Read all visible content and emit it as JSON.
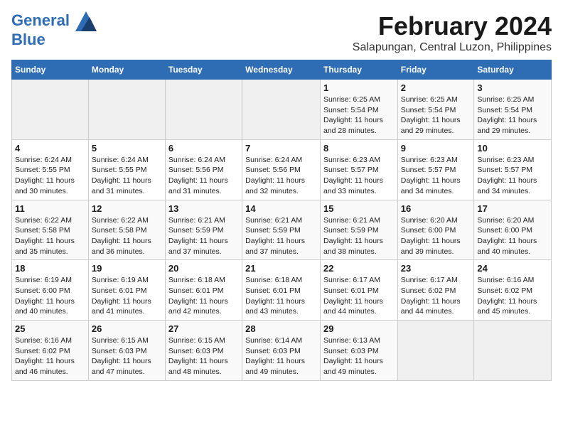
{
  "header": {
    "logo_line1": "General",
    "logo_line2": "Blue",
    "month_year": "February 2024",
    "location": "Salapungan, Central Luzon, Philippines"
  },
  "days_of_week": [
    "Sunday",
    "Monday",
    "Tuesday",
    "Wednesday",
    "Thursday",
    "Friday",
    "Saturday"
  ],
  "weeks": [
    [
      {
        "day": "",
        "info": ""
      },
      {
        "day": "",
        "info": ""
      },
      {
        "day": "",
        "info": ""
      },
      {
        "day": "",
        "info": ""
      },
      {
        "day": "1",
        "info": "Sunrise: 6:25 AM\nSunset: 5:54 PM\nDaylight: 11 hours and 28 minutes."
      },
      {
        "day": "2",
        "info": "Sunrise: 6:25 AM\nSunset: 5:54 PM\nDaylight: 11 hours and 29 minutes."
      },
      {
        "day": "3",
        "info": "Sunrise: 6:25 AM\nSunset: 5:54 PM\nDaylight: 11 hours and 29 minutes."
      }
    ],
    [
      {
        "day": "4",
        "info": "Sunrise: 6:24 AM\nSunset: 5:55 PM\nDaylight: 11 hours and 30 minutes."
      },
      {
        "day": "5",
        "info": "Sunrise: 6:24 AM\nSunset: 5:55 PM\nDaylight: 11 hours and 31 minutes."
      },
      {
        "day": "6",
        "info": "Sunrise: 6:24 AM\nSunset: 5:56 PM\nDaylight: 11 hours and 31 minutes."
      },
      {
        "day": "7",
        "info": "Sunrise: 6:24 AM\nSunset: 5:56 PM\nDaylight: 11 hours and 32 minutes."
      },
      {
        "day": "8",
        "info": "Sunrise: 6:23 AM\nSunset: 5:57 PM\nDaylight: 11 hours and 33 minutes."
      },
      {
        "day": "9",
        "info": "Sunrise: 6:23 AM\nSunset: 5:57 PM\nDaylight: 11 hours and 34 minutes."
      },
      {
        "day": "10",
        "info": "Sunrise: 6:23 AM\nSunset: 5:57 PM\nDaylight: 11 hours and 34 minutes."
      }
    ],
    [
      {
        "day": "11",
        "info": "Sunrise: 6:22 AM\nSunset: 5:58 PM\nDaylight: 11 hours and 35 minutes."
      },
      {
        "day": "12",
        "info": "Sunrise: 6:22 AM\nSunset: 5:58 PM\nDaylight: 11 hours and 36 minutes."
      },
      {
        "day": "13",
        "info": "Sunrise: 6:21 AM\nSunset: 5:59 PM\nDaylight: 11 hours and 37 minutes."
      },
      {
        "day": "14",
        "info": "Sunrise: 6:21 AM\nSunset: 5:59 PM\nDaylight: 11 hours and 37 minutes."
      },
      {
        "day": "15",
        "info": "Sunrise: 6:21 AM\nSunset: 5:59 PM\nDaylight: 11 hours and 38 minutes."
      },
      {
        "day": "16",
        "info": "Sunrise: 6:20 AM\nSunset: 6:00 PM\nDaylight: 11 hours and 39 minutes."
      },
      {
        "day": "17",
        "info": "Sunrise: 6:20 AM\nSunset: 6:00 PM\nDaylight: 11 hours and 40 minutes."
      }
    ],
    [
      {
        "day": "18",
        "info": "Sunrise: 6:19 AM\nSunset: 6:00 PM\nDaylight: 11 hours and 40 minutes."
      },
      {
        "day": "19",
        "info": "Sunrise: 6:19 AM\nSunset: 6:01 PM\nDaylight: 11 hours and 41 minutes."
      },
      {
        "day": "20",
        "info": "Sunrise: 6:18 AM\nSunset: 6:01 PM\nDaylight: 11 hours and 42 minutes."
      },
      {
        "day": "21",
        "info": "Sunrise: 6:18 AM\nSunset: 6:01 PM\nDaylight: 11 hours and 43 minutes."
      },
      {
        "day": "22",
        "info": "Sunrise: 6:17 AM\nSunset: 6:01 PM\nDaylight: 11 hours and 44 minutes."
      },
      {
        "day": "23",
        "info": "Sunrise: 6:17 AM\nSunset: 6:02 PM\nDaylight: 11 hours and 44 minutes."
      },
      {
        "day": "24",
        "info": "Sunrise: 6:16 AM\nSunset: 6:02 PM\nDaylight: 11 hours and 45 minutes."
      }
    ],
    [
      {
        "day": "25",
        "info": "Sunrise: 6:16 AM\nSunset: 6:02 PM\nDaylight: 11 hours and 46 minutes."
      },
      {
        "day": "26",
        "info": "Sunrise: 6:15 AM\nSunset: 6:03 PM\nDaylight: 11 hours and 47 minutes."
      },
      {
        "day": "27",
        "info": "Sunrise: 6:15 AM\nSunset: 6:03 PM\nDaylight: 11 hours and 48 minutes."
      },
      {
        "day": "28",
        "info": "Sunrise: 6:14 AM\nSunset: 6:03 PM\nDaylight: 11 hours and 49 minutes."
      },
      {
        "day": "29",
        "info": "Sunrise: 6:13 AM\nSunset: 6:03 PM\nDaylight: 11 hours and 49 minutes."
      },
      {
        "day": "",
        "info": ""
      },
      {
        "day": "",
        "info": ""
      }
    ]
  ]
}
